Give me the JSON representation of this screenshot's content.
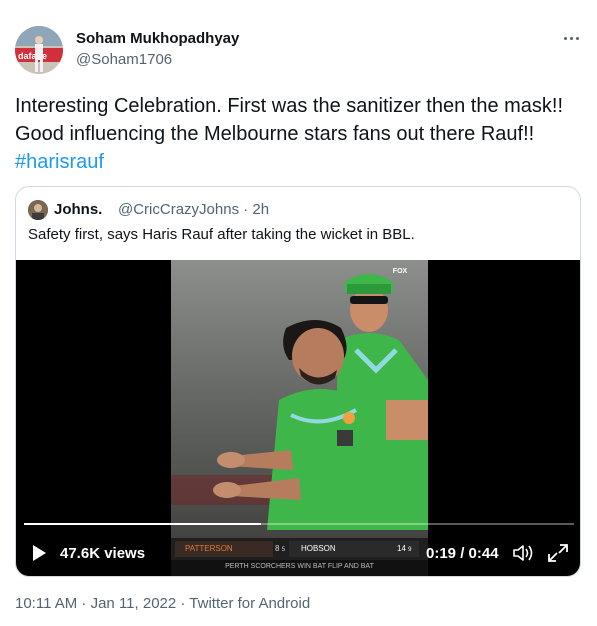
{
  "author": {
    "name": "Soham Mukhopadhyay",
    "handle": "@Soham1706",
    "avatar_icon": "profile-photo-cricketer"
  },
  "tweet": {
    "text_before": "Interesting Celebration. First was the sanitizer then the mask!! Good influencing the Melbourne stars fans out there Rauf!! ",
    "hashtag": "#harisrauf"
  },
  "quoted": {
    "name": "Johns.",
    "meta": "@CricCrazyJohns · 2h",
    "text": "Safety first, says Haris Rauf after taking the wicket in BBL.",
    "video": {
      "views": "47.6K views",
      "time": "0:19 / 0:44",
      "progress": 0.43,
      "broadcaster_logo": "FOX",
      "scoreboard": {
        "player_left": "PATTERSON",
        "score_left": "8",
        "balls_left": "5",
        "player_right": "HOBSON",
        "score_right": "14",
        "balls_right": "9",
        "ticker": "PERTH SCORCHERS WIN BAT FLIP AND BAT"
      }
    }
  },
  "footer": "10:11 AM · Jan 11, 2022 · Twitter for Android",
  "colors": {
    "link": "#1d9bf0",
    "text": "#0f1419",
    "muted": "#536471",
    "border": "#cfd9de",
    "jersey": "#3fb64a"
  }
}
